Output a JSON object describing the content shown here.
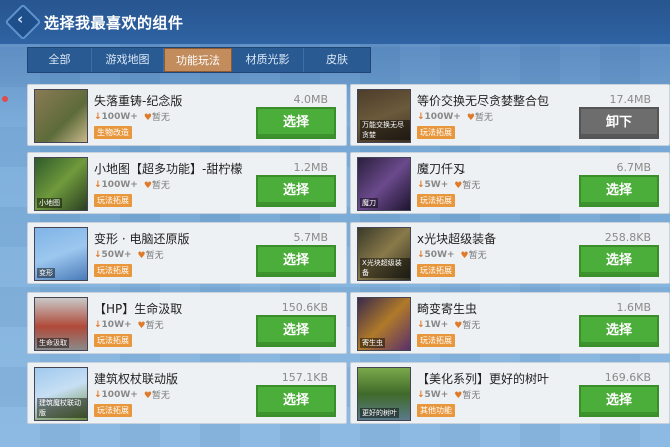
{
  "header": {
    "title": "选择我最喜欢的组件",
    "back_icon": "back-diamond-icon"
  },
  "tabs": [
    {
      "label": "全部",
      "active": false
    },
    {
      "label": "游戏地图",
      "active": false
    },
    {
      "label": "功能玩法",
      "active": true
    },
    {
      "label": "材质光影",
      "active": false
    },
    {
      "label": "皮肤",
      "active": false
    }
  ],
  "items": [
    {
      "name": "失落重铸-纪念版",
      "downloads": "100W+",
      "likes": "暂无",
      "tag": "生物改造",
      "size": "4.0MB",
      "button": "选择",
      "thumb_text": ""
    },
    {
      "name": "等价交换无尽贪婪整合包",
      "downloads": "100W+",
      "likes": "暂无",
      "tag": "玩法拓展",
      "size": "17.4MB",
      "button": "卸下",
      "thumb_text": "万能交换无尽贪婪"
    },
    {
      "name": "小地图【超多功能】-甜柠檬",
      "downloads": "100W+",
      "likes": "暂无",
      "tag": "玩法拓展",
      "size": "1.2MB",
      "button": "选择",
      "thumb_text": "小地图"
    },
    {
      "name": "魔刀仟刄",
      "downloads": "5W+",
      "likes": "暂无",
      "tag": "玩法拓展",
      "size": "6.7MB",
      "button": "选择",
      "thumb_text": "魔刀"
    },
    {
      "name": "变形 · 电脑还原版",
      "downloads": "50W+",
      "likes": "暂无",
      "tag": "玩法拓展",
      "size": "5.7MB",
      "button": "选择",
      "thumb_text": "变形"
    },
    {
      "name": "x光块超级装备",
      "downloads": "50W+",
      "likes": "暂无",
      "tag": "玩法拓展",
      "size": "258.8KB",
      "button": "选择",
      "thumb_text": "X光块超级装备"
    },
    {
      "name": "【HP】生命汲取",
      "downloads": "10W+",
      "likes": "暂无",
      "tag": "玩法拓展",
      "size": "150.6KB",
      "button": "选择",
      "thumb_text": "生命汲取"
    },
    {
      "name": "畸变寄生虫",
      "downloads": "1W+",
      "likes": "暂无",
      "tag": "玩法拓展",
      "size": "1.6MB",
      "button": "选择",
      "thumb_text": "寄生虫"
    },
    {
      "name": "建筑权杖联动版",
      "downloads": "100W+",
      "likes": "暂无",
      "tag": "玩法拓展",
      "size": "157.1KB",
      "button": "选择",
      "thumb_text": "建筑魔杖联动版"
    },
    {
      "name": "【美化系列】更好的树叶",
      "downloads": "5W+",
      "likes": "暂无",
      "tag": "其他功能",
      "size": "169.6KB",
      "button": "选择",
      "thumb_text": "更好的树叶"
    }
  ],
  "colors": {
    "select_button": "#4cae3a",
    "installed_button": "#6d6d6d",
    "tab_active": "#c28c5c",
    "tag": "#e8973d"
  }
}
